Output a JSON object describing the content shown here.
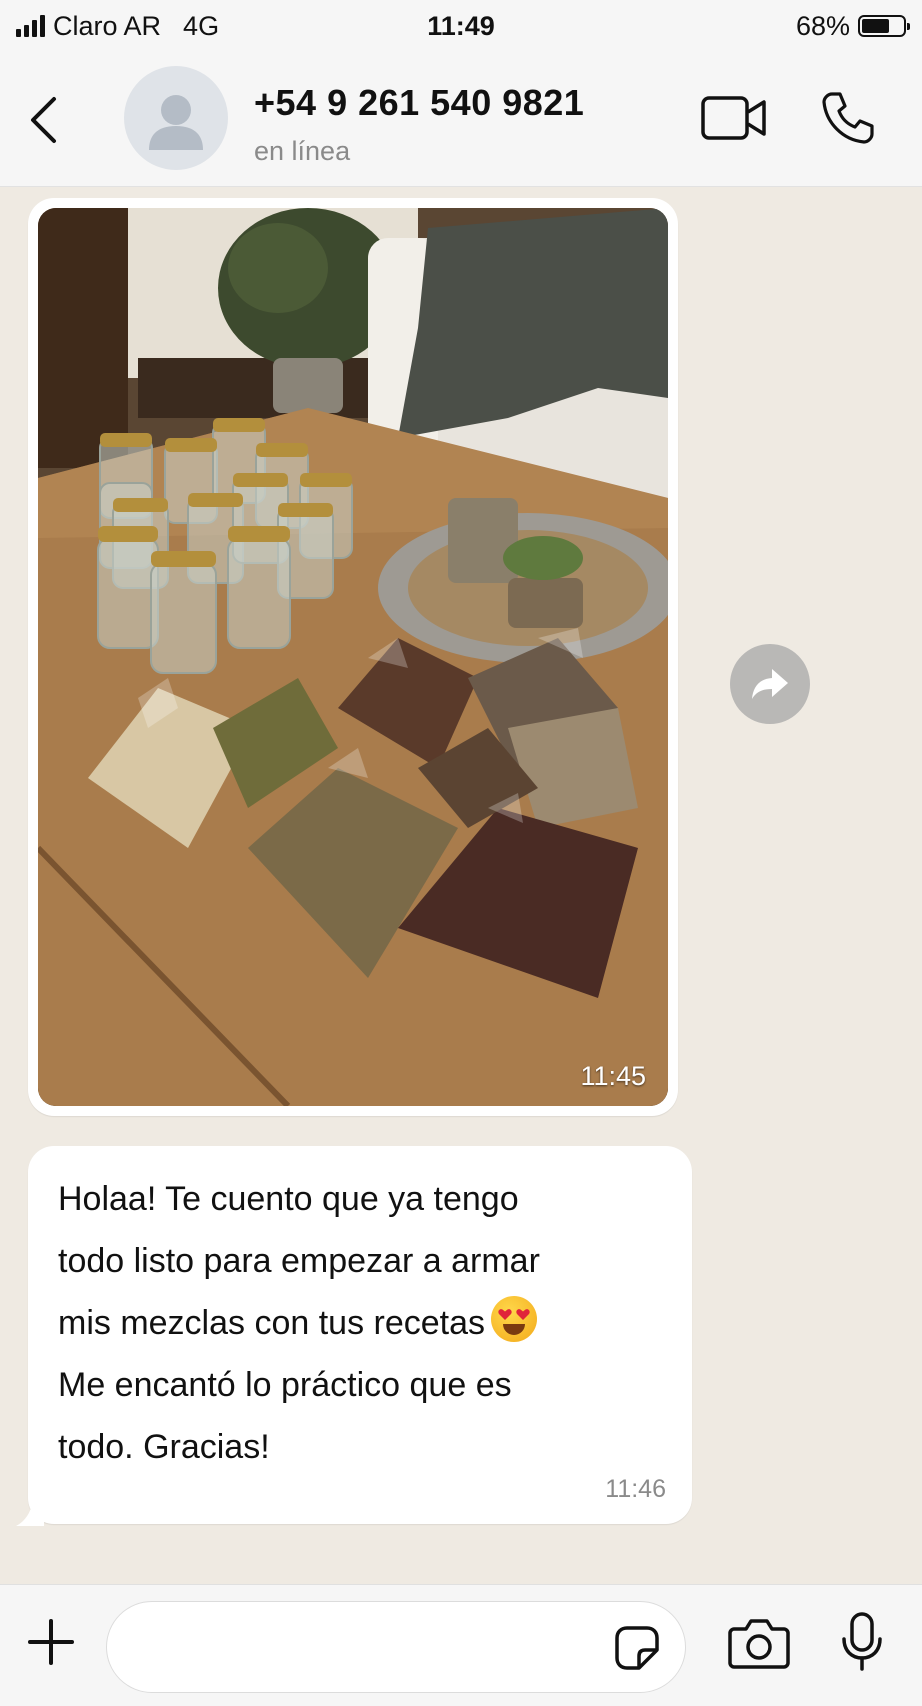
{
  "status_bar": {
    "carrier": "Claro AR",
    "network": "4G",
    "time": "11:49",
    "battery": "68%",
    "battery_level": 0.68
  },
  "header": {
    "contact_name": "+54 9 261 540 9821",
    "contact_status": "en línea",
    "back_icon": "chevron-left-icon",
    "video_icon": "video-call-icon",
    "call_icon": "phone-icon"
  },
  "messages": [
    {
      "type": "image",
      "time": "11:45"
    },
    {
      "type": "text",
      "text_before_emoji": "Holaa! Te cuento que ya tengo\ntodo listo para empezar a armar\nmis mezclas con tus recetas",
      "emoji": "heart-eyes-emoji",
      "text_after_emoji": "\nMe encantó lo práctico que es\ntodo. Gracias!",
      "time": "11:46"
    }
  ],
  "composer": {
    "placeholder": "",
    "plus_icon": "plus-icon",
    "sticker_icon": "sticker-icon",
    "camera_icon": "camera-icon",
    "mic_icon": "microphone-icon"
  },
  "colors": {
    "chat_background": "#efeae2",
    "bubble": "#ffffff",
    "bar_background": "#f6f6f6",
    "secondary_text": "#8a8a8a"
  }
}
